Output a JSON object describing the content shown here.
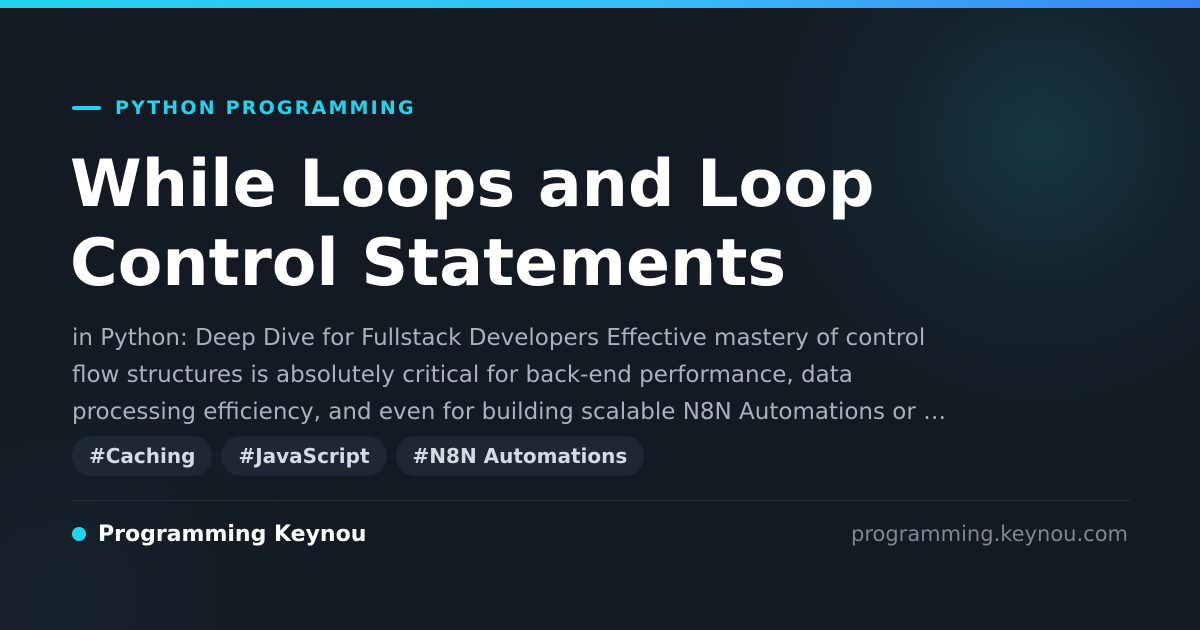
{
  "category": "PYTHON PROGRAMMING",
  "title_lines": [
    "While Loops and Loop",
    "Control Statements"
  ],
  "excerpt_lines": [
    "in Python: Deep Dive for Fullstack Developers Effective mastery of control",
    "flow structures is absolutely critical for back-end performance, data",
    "processing efficiency, and even for building scalable N8N Automations or …"
  ],
  "tags": [
    "#Caching",
    "#JavaScript",
    "#N8N Automations"
  ],
  "brand": {
    "name": "Programming Keynou",
    "url": "programming.keynou.com"
  },
  "colors": {
    "accent": "#22d3ee",
    "background": "#141a23",
    "title": "#ffffff",
    "excerpt": "#a8b2bf",
    "tag_background": "#1d2834",
    "url": "#7d8893"
  }
}
